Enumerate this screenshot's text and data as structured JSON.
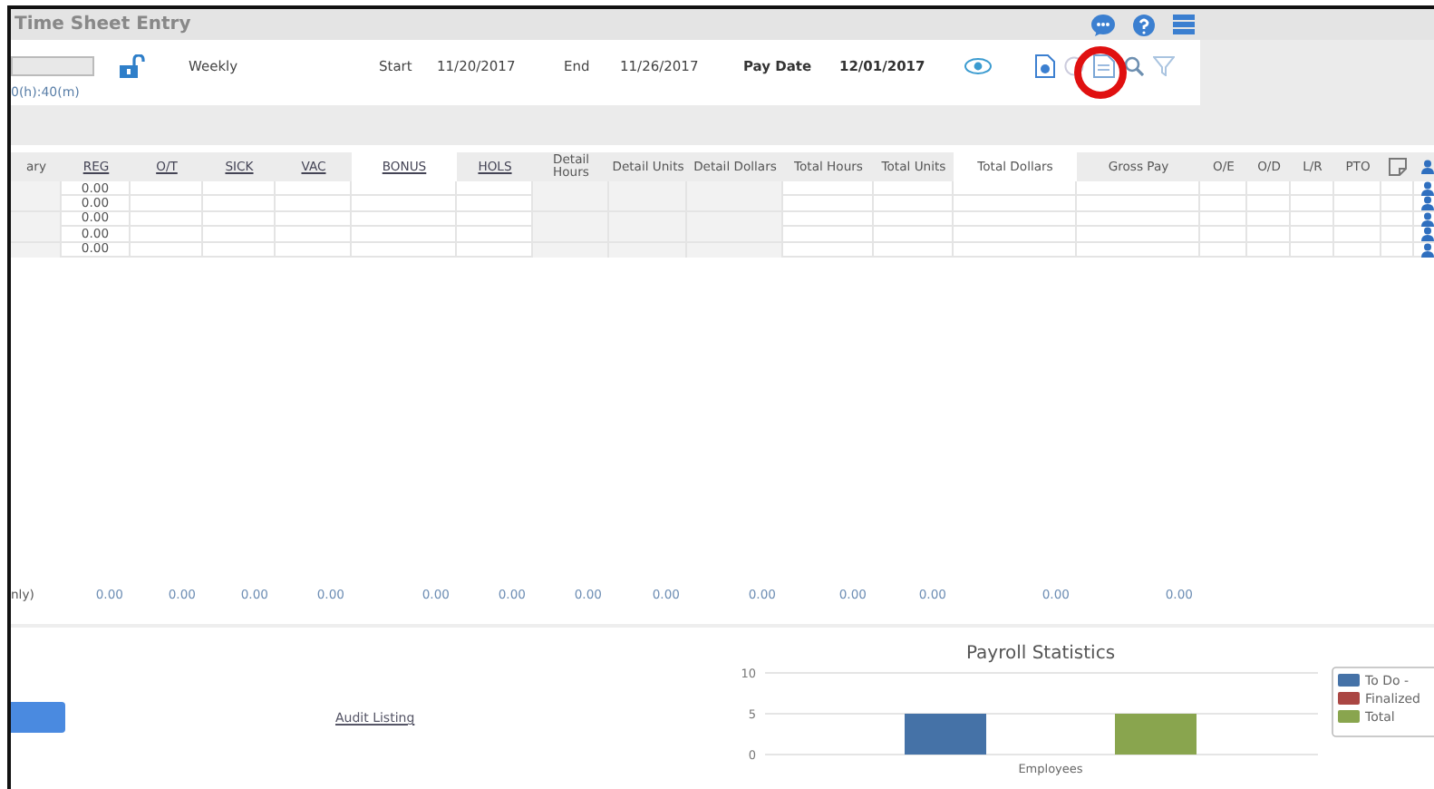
{
  "window": {
    "title": "Time Sheet Entry"
  },
  "header": {
    "period": "Weekly",
    "start_label": "Start",
    "start": "11/20/2017",
    "end_label": "End",
    "end": "11/26/2017",
    "pay_date_label": "Pay Date",
    "pay_date": "12/01/2017",
    "duration": "0(h):40(m)"
  },
  "table": {
    "columns": [
      {
        "label": "ary",
        "kind": "text",
        "highlighted": false
      },
      {
        "label": "REG",
        "kind": "link",
        "highlighted": false
      },
      {
        "label": "O/T",
        "kind": "link",
        "highlighted": false
      },
      {
        "label": "SICK",
        "kind": "link",
        "highlighted": false
      },
      {
        "label": "VAC",
        "kind": "link",
        "highlighted": false
      },
      {
        "label": "BONUS",
        "kind": "link",
        "highlighted": true
      },
      {
        "label": "HOLS",
        "kind": "link",
        "highlighted": false
      },
      {
        "label": "Detail Hours",
        "kind": "text",
        "highlighted": false
      },
      {
        "label": "Detail Units",
        "kind": "text",
        "highlighted": false
      },
      {
        "label": "Detail Dollars",
        "kind": "text",
        "highlighted": false
      },
      {
        "label": "Total Hours",
        "kind": "text",
        "highlighted": false
      },
      {
        "label": "Total Units",
        "kind": "text",
        "highlighted": false
      },
      {
        "label": "Total Dollars",
        "kind": "text",
        "highlighted": true
      },
      {
        "label": "Gross Pay",
        "kind": "text",
        "highlighted": false
      },
      {
        "label": "O/E",
        "kind": "text",
        "highlighted": false
      },
      {
        "label": "O/D",
        "kind": "text",
        "highlighted": false
      },
      {
        "label": "L/R",
        "kind": "text",
        "highlighted": false
      },
      {
        "label": "PTO",
        "kind": "text",
        "highlighted": false
      }
    ],
    "rows": [
      {
        "reg": "0.00"
      },
      {
        "reg": "0.00"
      },
      {
        "reg": "0.00"
      },
      {
        "reg": "0.00"
      },
      {
        "reg": "0.00"
      }
    ],
    "totals": {
      "label": "nly)",
      "values": [
        "0.00",
        "0.00",
        "0.00",
        "0.00",
        "0.00",
        "0.00",
        "0.00",
        "0.00",
        "0.00",
        "0.00",
        "0.00",
        "0.00",
        "0.00"
      ]
    }
  },
  "footer": {
    "link": "Audit Listing"
  },
  "chart_data": {
    "type": "bar",
    "title": "Payroll Statistics",
    "legend": "right",
    "categories": [
      "Employees"
    ],
    "ylim": [
      0,
      10
    ],
    "yticks": [
      0,
      5,
      10
    ],
    "series": [
      {
        "name": "To Do -",
        "color": "#4572a7",
        "values": [
          5
        ]
      },
      {
        "name": "Finalized",
        "color": "#aa4643",
        "values": [
          0
        ]
      },
      {
        "name": "Total",
        "color": "#89a54e",
        "values": [
          5
        ]
      }
    ]
  }
}
